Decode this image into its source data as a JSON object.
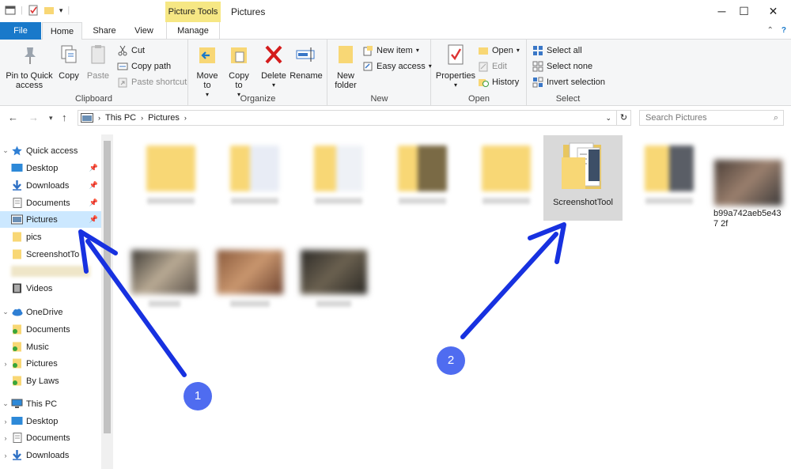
{
  "window": {
    "context_tab": "Picture Tools",
    "title": "Pictures"
  },
  "tabs": [
    {
      "label": "File"
    },
    {
      "label": "Home"
    },
    {
      "label": "Share"
    },
    {
      "label": "View"
    },
    {
      "label": "Manage"
    }
  ],
  "ribbon": {
    "clipboard": {
      "pin_label": "Pin to Quick access",
      "copy_label": "Copy",
      "paste_label": "Paste",
      "cut_label": "Cut",
      "copy_path_label": "Copy path",
      "paste_shortcut_label": "Paste shortcut",
      "group_label": "Clipboard"
    },
    "organize": {
      "move_to_label": "Move to",
      "copy_to_label": "Copy to",
      "delete_label": "Delete",
      "rename_label": "Rename",
      "group_label": "Organize"
    },
    "new": {
      "new_folder_label": "New folder",
      "new_item_label": "New item",
      "easy_access_label": "Easy access",
      "group_label": "New"
    },
    "open": {
      "properties_label": "Properties",
      "open_label": "Open",
      "edit_label": "Edit",
      "history_label": "History",
      "group_label": "Open"
    },
    "select": {
      "select_all_label": "Select all",
      "select_none_label": "Select none",
      "invert_label": "Invert selection",
      "group_label": "Select"
    }
  },
  "address": {
    "crumbs": [
      "This PC",
      "Pictures"
    ],
    "search_placeholder": "Search Pictures"
  },
  "nav": {
    "quick_access": "Quick access",
    "items_quick": [
      "Desktop",
      "Downloads",
      "Documents",
      "Pictures",
      "pics",
      "ScreenshotTo",
      "Videos"
    ],
    "onedrive": "OneDrive",
    "items_onedrive": [
      "Documents",
      "Music",
      "Pictures",
      "By Laws"
    ],
    "this_pc": "This PC",
    "items_pc": [
      "Desktop",
      "Documents",
      "Downloads"
    ]
  },
  "content": {
    "selected_folder": "ScreenshotTool",
    "image_file": "b99a742aeb5e437 2f"
  },
  "annotations": [
    {
      "number": "1"
    },
    {
      "number": "2"
    }
  ],
  "colors": {
    "file_tab": "#1979ca",
    "context_tab": "#f6e784",
    "selection": "#cce8ff",
    "arrow": "#1731e0",
    "badge": "#4f6cf0",
    "folder": "#f8d775"
  }
}
